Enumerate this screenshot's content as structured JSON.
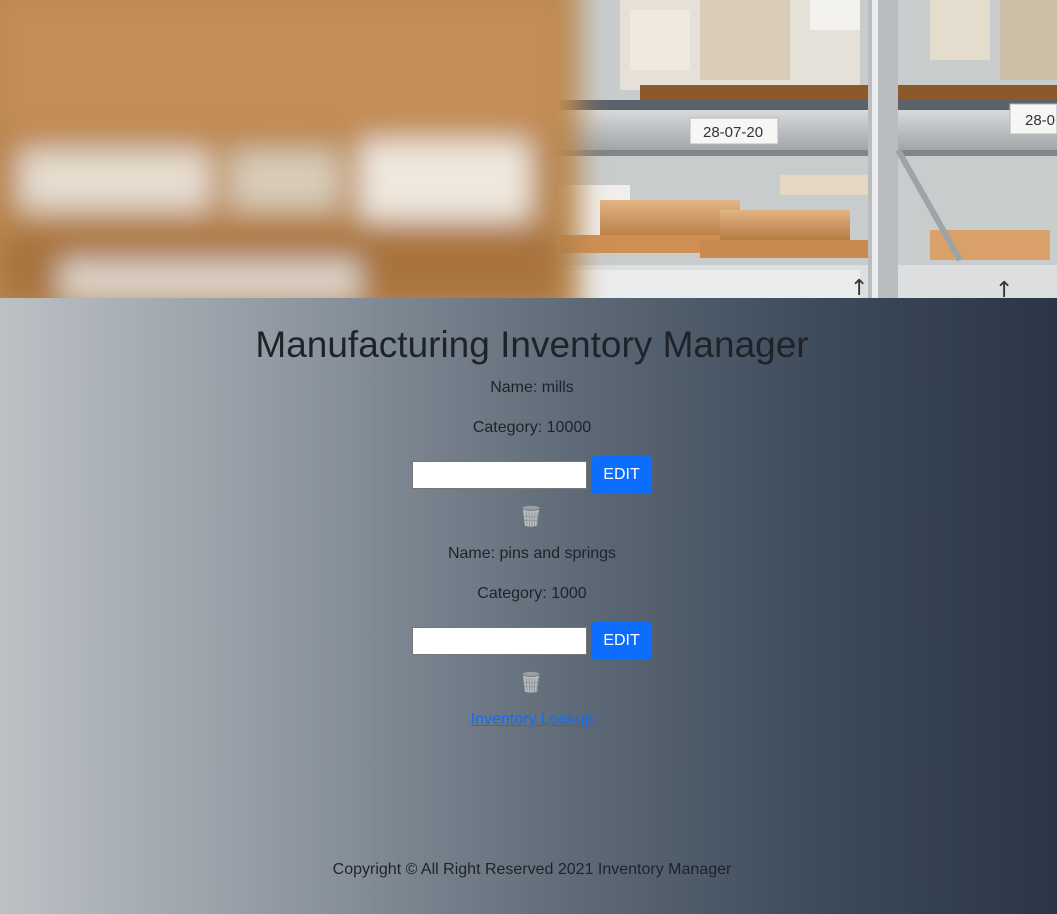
{
  "page": {
    "title": "Manufacturing Inventory Manager"
  },
  "hero": {
    "image": "warehouse-shelves",
    "shelf_labels": [
      "28-07-20",
      "28-0"
    ]
  },
  "items": [
    {
      "name_text": "Name: mills",
      "category_text": "Category: 10000",
      "input_value": "",
      "edit_label": "EDIT",
      "delete_icon": "trash-icon"
    },
    {
      "name_text": "Name: pins and springs",
      "category_text": "Category: 1000",
      "input_value": "",
      "edit_label": "EDIT",
      "delete_icon": "trash-icon"
    }
  ],
  "links": {
    "lookup_label": "Inventory Lookup"
  },
  "footer": {
    "copyright": "Copyright © All Right Reserved 2021 Inventory Manager"
  },
  "colors": {
    "accent": "#0d6efd",
    "gradient_start": "#bcc1c5",
    "gradient_end": "#2a3647",
    "text": "#1e2329"
  }
}
